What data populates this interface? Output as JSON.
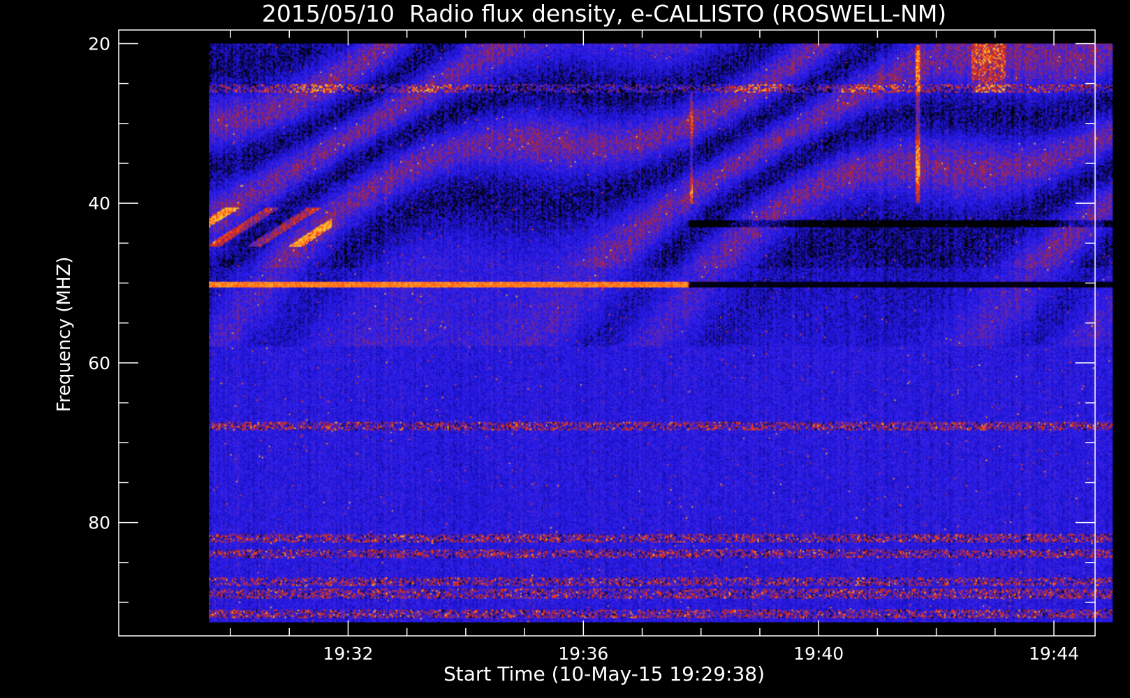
{
  "chart_data": {
    "type": "heatmap",
    "title": "2015/05/10  Radio flux density, e-CALLISTO (ROSWELL-NM)",
    "xlabel": "Start Time (10-May-15 19:29:38)",
    "ylabel": "Frequency (MHZ)",
    "x_tick_labels": [
      "19:32",
      "19:36",
      "19:40",
      "19:44"
    ],
    "x_ticks_minutes": [
      32,
      36,
      40,
      44
    ],
    "x_minor_ticks_minutes": [
      30,
      31,
      32,
      33,
      34,
      35,
      36,
      37,
      38,
      39,
      40,
      41,
      42,
      43,
      44,
      45
    ],
    "x_range_minutes": [
      29.633,
      45
    ],
    "x_axis_range_minutes": [
      28.1,
      44.7
    ],
    "y_tick_labels": [
      "20",
      "40",
      "60",
      "80"
    ],
    "y_ticks": [
      20,
      40,
      60,
      80
    ],
    "y_minor_tick_step": 5,
    "y_range": [
      20,
      92.5
    ],
    "y_axis_range": [
      18.3,
      94.2
    ],
    "y_reversed": true,
    "grid": false,
    "colormap": [
      "#000000",
      "#1a10c8",
      "#3222f0",
      "#b82a2a",
      "#ff3a10",
      "#ffc030"
    ],
    "features": {
      "bright_horizontal_line_mhz": 50.1,
      "line_ends_minute": 37.8,
      "dark_line_after_minute": 37.8,
      "noisy_bands_mhz": [
        25.5,
        68,
        82,
        84,
        87.5,
        89,
        91.5
      ],
      "vertical_burst_minute": 41.7,
      "vertical_burst_range_mhz": [
        20,
        40
      ]
    }
  },
  "colors": {
    "background": "#000000",
    "axis": "#ffffff",
    "text": "#ffffff"
  }
}
